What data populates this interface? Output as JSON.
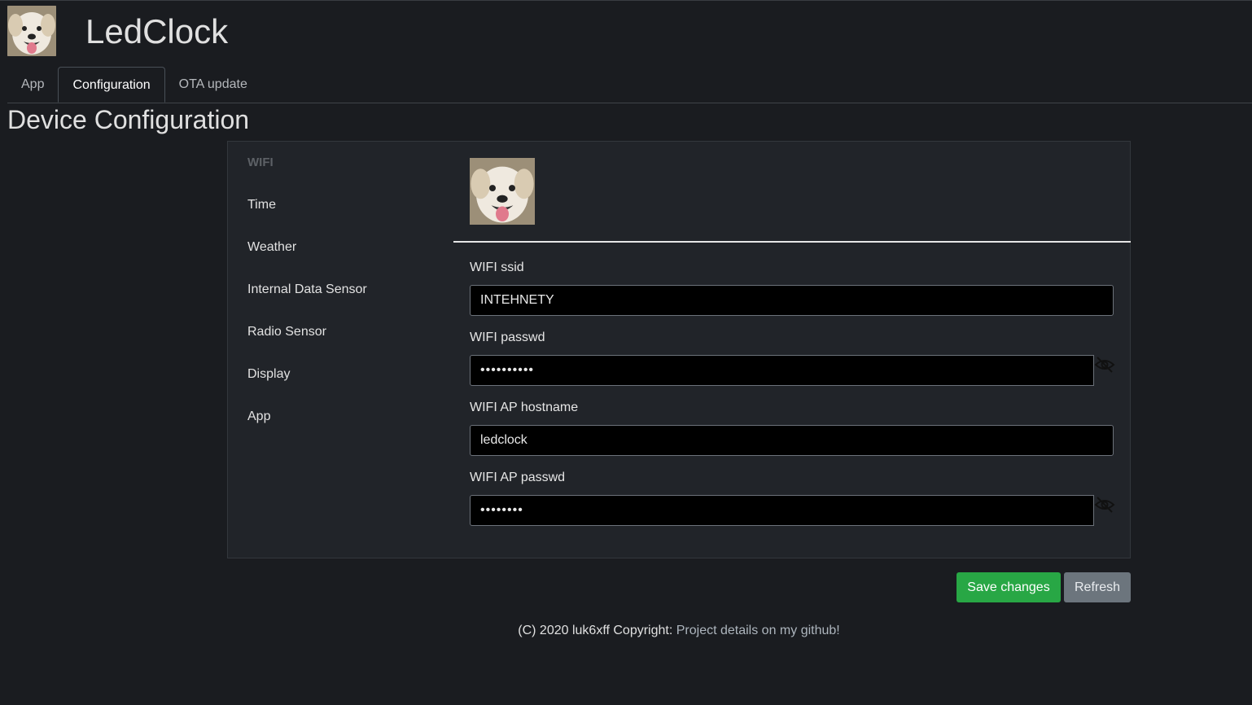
{
  "header": {
    "app_title": "LedClock",
    "logo_alt": "dog-avatar"
  },
  "tabs": [
    {
      "label": "App",
      "active": false
    },
    {
      "label": "Configuration",
      "active": true
    },
    {
      "label": "OTA update",
      "active": false
    }
  ],
  "page": {
    "heading": "Device Configuration"
  },
  "sidebar": {
    "items": [
      {
        "label": "WIFI",
        "disabled": true
      },
      {
        "label": "Time"
      },
      {
        "label": "Weather"
      },
      {
        "label": "Internal Data Sensor"
      },
      {
        "label": "Radio Sensor"
      },
      {
        "label": "Display"
      },
      {
        "label": "App"
      }
    ]
  },
  "form": {
    "wifi_ssid": {
      "label": "WIFI ssid",
      "value": "INTEHNETY"
    },
    "wifi_passwd": {
      "label": "WIFI passwd",
      "value": "••••••••••"
    },
    "wifi_ap_hostname": {
      "label": "WIFI AP hostname",
      "value": "ledclock"
    },
    "wifi_ap_passwd": {
      "label": "WIFI AP passwd",
      "value": "••••••••"
    }
  },
  "buttons": {
    "save_label": "Save changes",
    "refresh_label": "Refresh"
  },
  "footer": {
    "copyright": "(C) 2020 luk6xff Copyright: ",
    "link_text": "Project details on my github!"
  },
  "colors": {
    "background": "#1a1c20",
    "card": "#212429",
    "save": "#28a745",
    "refresh": "#6c757d"
  }
}
